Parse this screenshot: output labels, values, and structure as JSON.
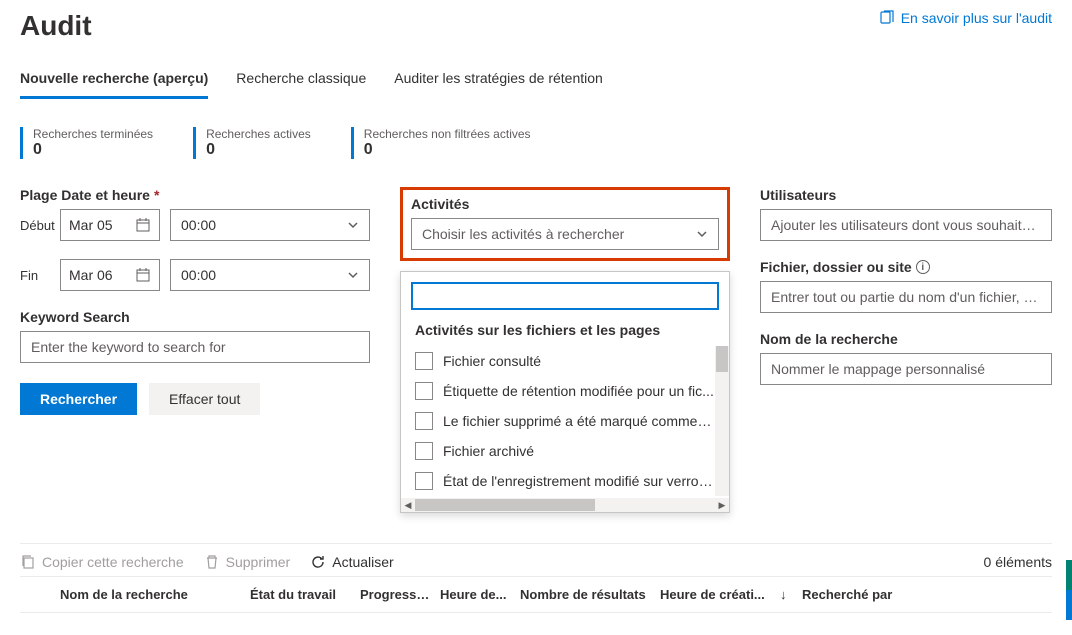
{
  "header": {
    "title": "Audit",
    "learn_more": "En savoir plus sur l'audit"
  },
  "tabs": [
    {
      "label": "Nouvelle recherche (aperçu)",
      "active": true
    },
    {
      "label": "Recherche classique",
      "active": false
    },
    {
      "label": "Auditer les stratégies de rétention",
      "active": false
    }
  ],
  "stats": {
    "completed": {
      "label": "Recherches terminées",
      "value": "0"
    },
    "active": {
      "label": "Recherches actives",
      "value": "0"
    },
    "unfiltered": {
      "label": "Recherches non filtrées actives",
      "value": "0"
    }
  },
  "daterange": {
    "label": "Plage Date et heure",
    "start_label": "Début",
    "end_label": "Fin",
    "start_date": "Mar 05",
    "start_time": "00:00",
    "end_date": "Mar 06",
    "end_time": "00:00"
  },
  "keyword": {
    "label": "Keyword Search",
    "placeholder": "Enter the keyword to search for"
  },
  "buttons": {
    "search": "Rechercher",
    "clear": "Effacer tout"
  },
  "activities": {
    "label": "Activités",
    "placeholder": "Choisir les activités à rechercher",
    "group_label": "Activités sur les fichiers et les pages",
    "items": [
      "Fichier consulté",
      "Étiquette de rétention modifiée pour un fic...",
      "Le fichier supprimé a été marqué comme e...",
      "Fichier archivé",
      "État de l'enregistrement modifié sur verroui.."
    ]
  },
  "users": {
    "label": "Utilisateurs",
    "placeholder": "Ajouter les utilisateurs dont vous souhaitez rech..."
  },
  "file": {
    "label": "Fichier, dossier ou site",
    "placeholder": "Entrer tout ou partie du nom d'un fichier, d'un s..."
  },
  "search_name": {
    "label": "Nom de la recherche",
    "placeholder": "Nommer le mappage personnalisé"
  },
  "toolbar": {
    "copy": "Copier cette recherche",
    "delete": "Supprimer",
    "refresh": "Actualiser",
    "count": "0 éléments"
  },
  "table": {
    "name": "Nom de la recherche",
    "state": "État du travail",
    "progress": "Progressi...",
    "time": "Heure de...",
    "results": "Nombre de résultats",
    "created": "Heure de créati...",
    "searched_by": "Recherché par"
  }
}
